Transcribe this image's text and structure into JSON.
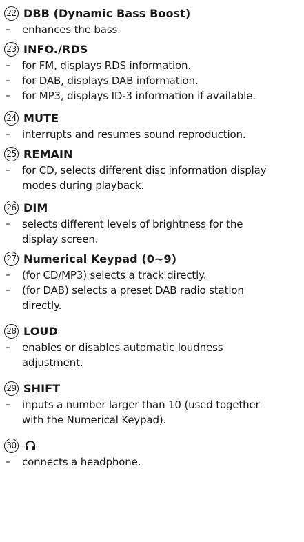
{
  "sections": [
    {
      "number": "22",
      "title": "DBB (Dynamic Bass Boost)",
      "items": [
        [
          "enhances the bass."
        ]
      ]
    },
    {
      "number": "23",
      "title": "INFO./RDS",
      "items": [
        [
          "for FM, displays RDS information."
        ],
        [
          "for DAB, displays DAB information."
        ],
        [
          "for MP3, displays ID-3 information if available."
        ]
      ]
    },
    {
      "number": "24",
      "title": "MUTE",
      "items": [
        [
          "interrupts and resumes sound reproduction."
        ]
      ]
    },
    {
      "number": "25",
      "title": "REMAIN",
      "items": [
        [
          "for CD, selects different disc information display",
          "modes during playback."
        ]
      ]
    },
    {
      "number": "26",
      "title": "DIM",
      "items": [
        [
          "selects different levels of brightness for the",
          "display screen."
        ]
      ]
    },
    {
      "number": "27",
      "title": "Numerical Keypad (0~9)",
      "items": [
        [
          "(for CD/MP3) selects a track directly."
        ],
        [
          "(for DAB) selects a preset DAB radio station",
          "directly."
        ]
      ]
    },
    {
      "number": "28",
      "title": "LOUD",
      "items": [
        [
          "enables or disables automatic loudness",
          "adjustment."
        ]
      ]
    },
    {
      "number": "29",
      "title": "SHIFT",
      "items": [
        [
          "inputs a number larger than 10 (used together",
          "with the Numerical Keypad)."
        ]
      ]
    },
    {
      "number": "30",
      "title": "",
      "icon": "headphone-icon",
      "items": [
        [
          "connects a headphone."
        ]
      ]
    }
  ],
  "dash_symbol": "–"
}
